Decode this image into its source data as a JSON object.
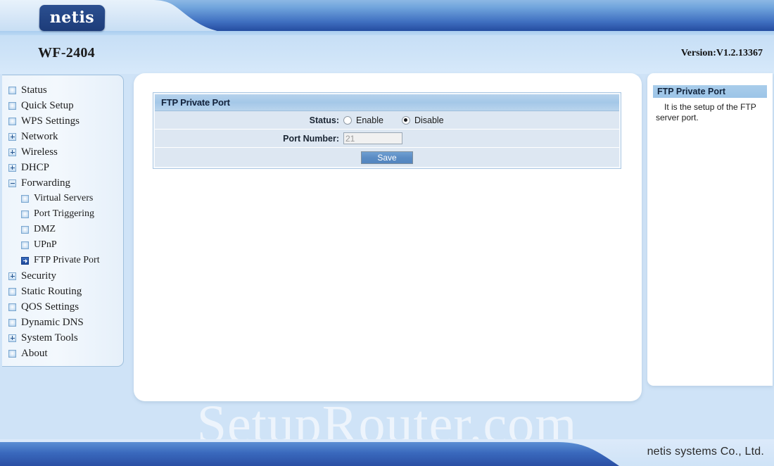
{
  "header": {
    "logo_text": "netis",
    "model": "WF-2404",
    "version": "Version:V1.2.13367"
  },
  "sidebar": {
    "items": [
      {
        "label": "Status",
        "icon": "leaf-icon",
        "level": 0,
        "state": "normal"
      },
      {
        "label": "Quick Setup",
        "icon": "leaf-icon",
        "level": 0,
        "state": "normal"
      },
      {
        "label": "WPS Settings",
        "icon": "leaf-icon",
        "level": 0,
        "state": "normal"
      },
      {
        "label": "Network",
        "icon": "plus-icon",
        "level": 0,
        "state": "collapsed"
      },
      {
        "label": "Wireless",
        "icon": "plus-icon",
        "level": 0,
        "state": "collapsed"
      },
      {
        "label": "DHCP",
        "icon": "plus-icon",
        "level": 0,
        "state": "collapsed"
      },
      {
        "label": "Forwarding",
        "icon": "minus-icon",
        "level": 0,
        "state": "expanded"
      },
      {
        "label": "Virtual Servers",
        "icon": "leaf-icon",
        "level": 1,
        "state": "normal"
      },
      {
        "label": "Port Triggering",
        "icon": "leaf-icon",
        "level": 1,
        "state": "normal"
      },
      {
        "label": "DMZ",
        "icon": "leaf-icon",
        "level": 1,
        "state": "normal"
      },
      {
        "label": "UPnP",
        "icon": "leaf-icon",
        "level": 1,
        "state": "normal"
      },
      {
        "label": "FTP Private Port",
        "icon": "arrow-icon",
        "level": 1,
        "state": "active"
      },
      {
        "label": "Security",
        "icon": "plus-icon",
        "level": 0,
        "state": "collapsed"
      },
      {
        "label": "Static Routing",
        "icon": "leaf-icon",
        "level": 0,
        "state": "normal"
      },
      {
        "label": "QOS Settings",
        "icon": "leaf-icon",
        "level": 0,
        "state": "normal"
      },
      {
        "label": "Dynamic DNS",
        "icon": "leaf-icon",
        "level": 0,
        "state": "normal"
      },
      {
        "label": "System Tools",
        "icon": "plus-icon",
        "level": 0,
        "state": "collapsed"
      },
      {
        "label": "About",
        "icon": "leaf-icon",
        "level": 0,
        "state": "normal"
      }
    ]
  },
  "form": {
    "title": "FTP Private Port",
    "status_label": "Status:",
    "radio_enable_label": "Enable",
    "radio_disable_label": "Disable",
    "status_selected": "Disable",
    "port_label": "Port Number:",
    "port_value": "21",
    "port_placeholder": "21",
    "save_label": "Save"
  },
  "help": {
    "title": "FTP Private Port",
    "body": "It is the setup of the FTP server port."
  },
  "watermark": {
    "text": "SetupRouter.com"
  },
  "footer": {
    "company": "netis systems Co., Ltd."
  },
  "colors": {
    "banner_dark_blue": "#20479b",
    "banner_light_blue": "#8cb8e4",
    "page_background": "#cfe3f7",
    "form_row_background": "#dde7f2",
    "form_title_background": "#a4c8e8",
    "save_button_blue": "#5b8cc4",
    "accent_border": "#a8c6e2"
  }
}
